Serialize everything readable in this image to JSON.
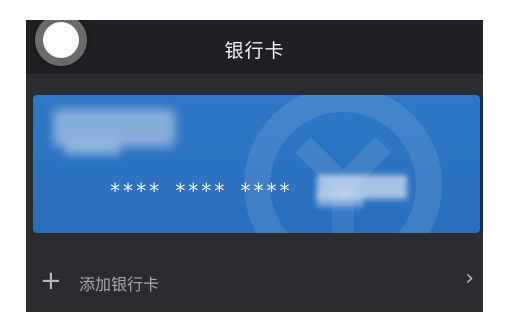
{
  "header": {
    "title": "银行卡",
    "back_icon": "circle-back-icon"
  },
  "card": {
    "bank_name": "",
    "masked_number": "**** **** ****",
    "last_digits": "",
    "color": "#2f77c6",
    "watermark_icon": "bank-logo-icon"
  },
  "add_card": {
    "plus_icon": "plus-icon",
    "label": "添加银行卡",
    "chevron_icon": "chevron-right-icon"
  },
  "colors": {
    "background": "#2a2c30",
    "titlebar": "#1f2023",
    "card_blue": "#2f77c6",
    "text_primary": "#f2f2f2",
    "text_secondary": "#a7a7a7"
  }
}
